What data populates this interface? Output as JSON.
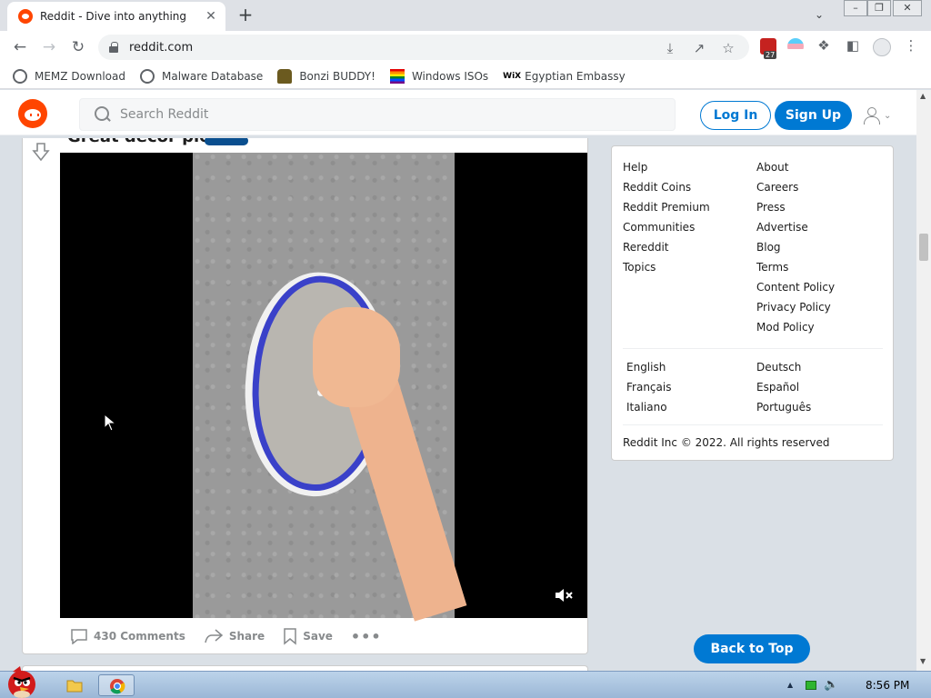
{
  "browser": {
    "tab_title": "Reddit - Dive into anything",
    "tab_close": "✕",
    "new_tab": "+",
    "url": "reddit.com",
    "extension_badge": "27",
    "bookmarks": [
      {
        "label": "MEMZ Download",
        "icon": "globe-icon",
        "color": "#5f6368"
      },
      {
        "label": "Malware Database",
        "icon": "globe-icon",
        "color": "#5f6368"
      },
      {
        "label": "Bonzi BUDDY!",
        "icon": "bonzi-icon",
        "color": "#6b5a1f"
      },
      {
        "label": "Windows ISOs",
        "icon": "rainbow-flag-icon",
        "color": "#e40303"
      },
      {
        "label": "Egyptian Embassy",
        "icon": "wix-icon",
        "color": "#000000"
      }
    ]
  },
  "reddit": {
    "search_placeholder": "Search Reddit",
    "login_label": "Log In",
    "signup_label": "Sign Up",
    "post": {
      "title": "Great decor piece",
      "comments_label": "430 Comments",
      "share_label": "Share",
      "save_label": "Save",
      "more_label": "•••"
    },
    "footer": {
      "col1": [
        "Help",
        "Reddit Coins",
        "Reddit Premium",
        "Communities",
        "Rereddit",
        "Topics"
      ],
      "col2": [
        "About",
        "Careers",
        "Press",
        "Advertise",
        "Blog",
        "Terms",
        "Content Policy",
        "Privacy Policy",
        "Mod Policy"
      ],
      "languages_col1": [
        "English",
        "Français",
        "Italiano"
      ],
      "languages_col2": [
        "Deutsch",
        "Español",
        "Português"
      ],
      "copyright": "Reddit Inc © 2022. All rights reserved"
    },
    "back_to_top": "Back to Top"
  },
  "taskbar": {
    "clock": "8:56 PM"
  },
  "colors": {
    "reddit_orange": "#ff4500",
    "reddit_blue": "#0079d3"
  }
}
